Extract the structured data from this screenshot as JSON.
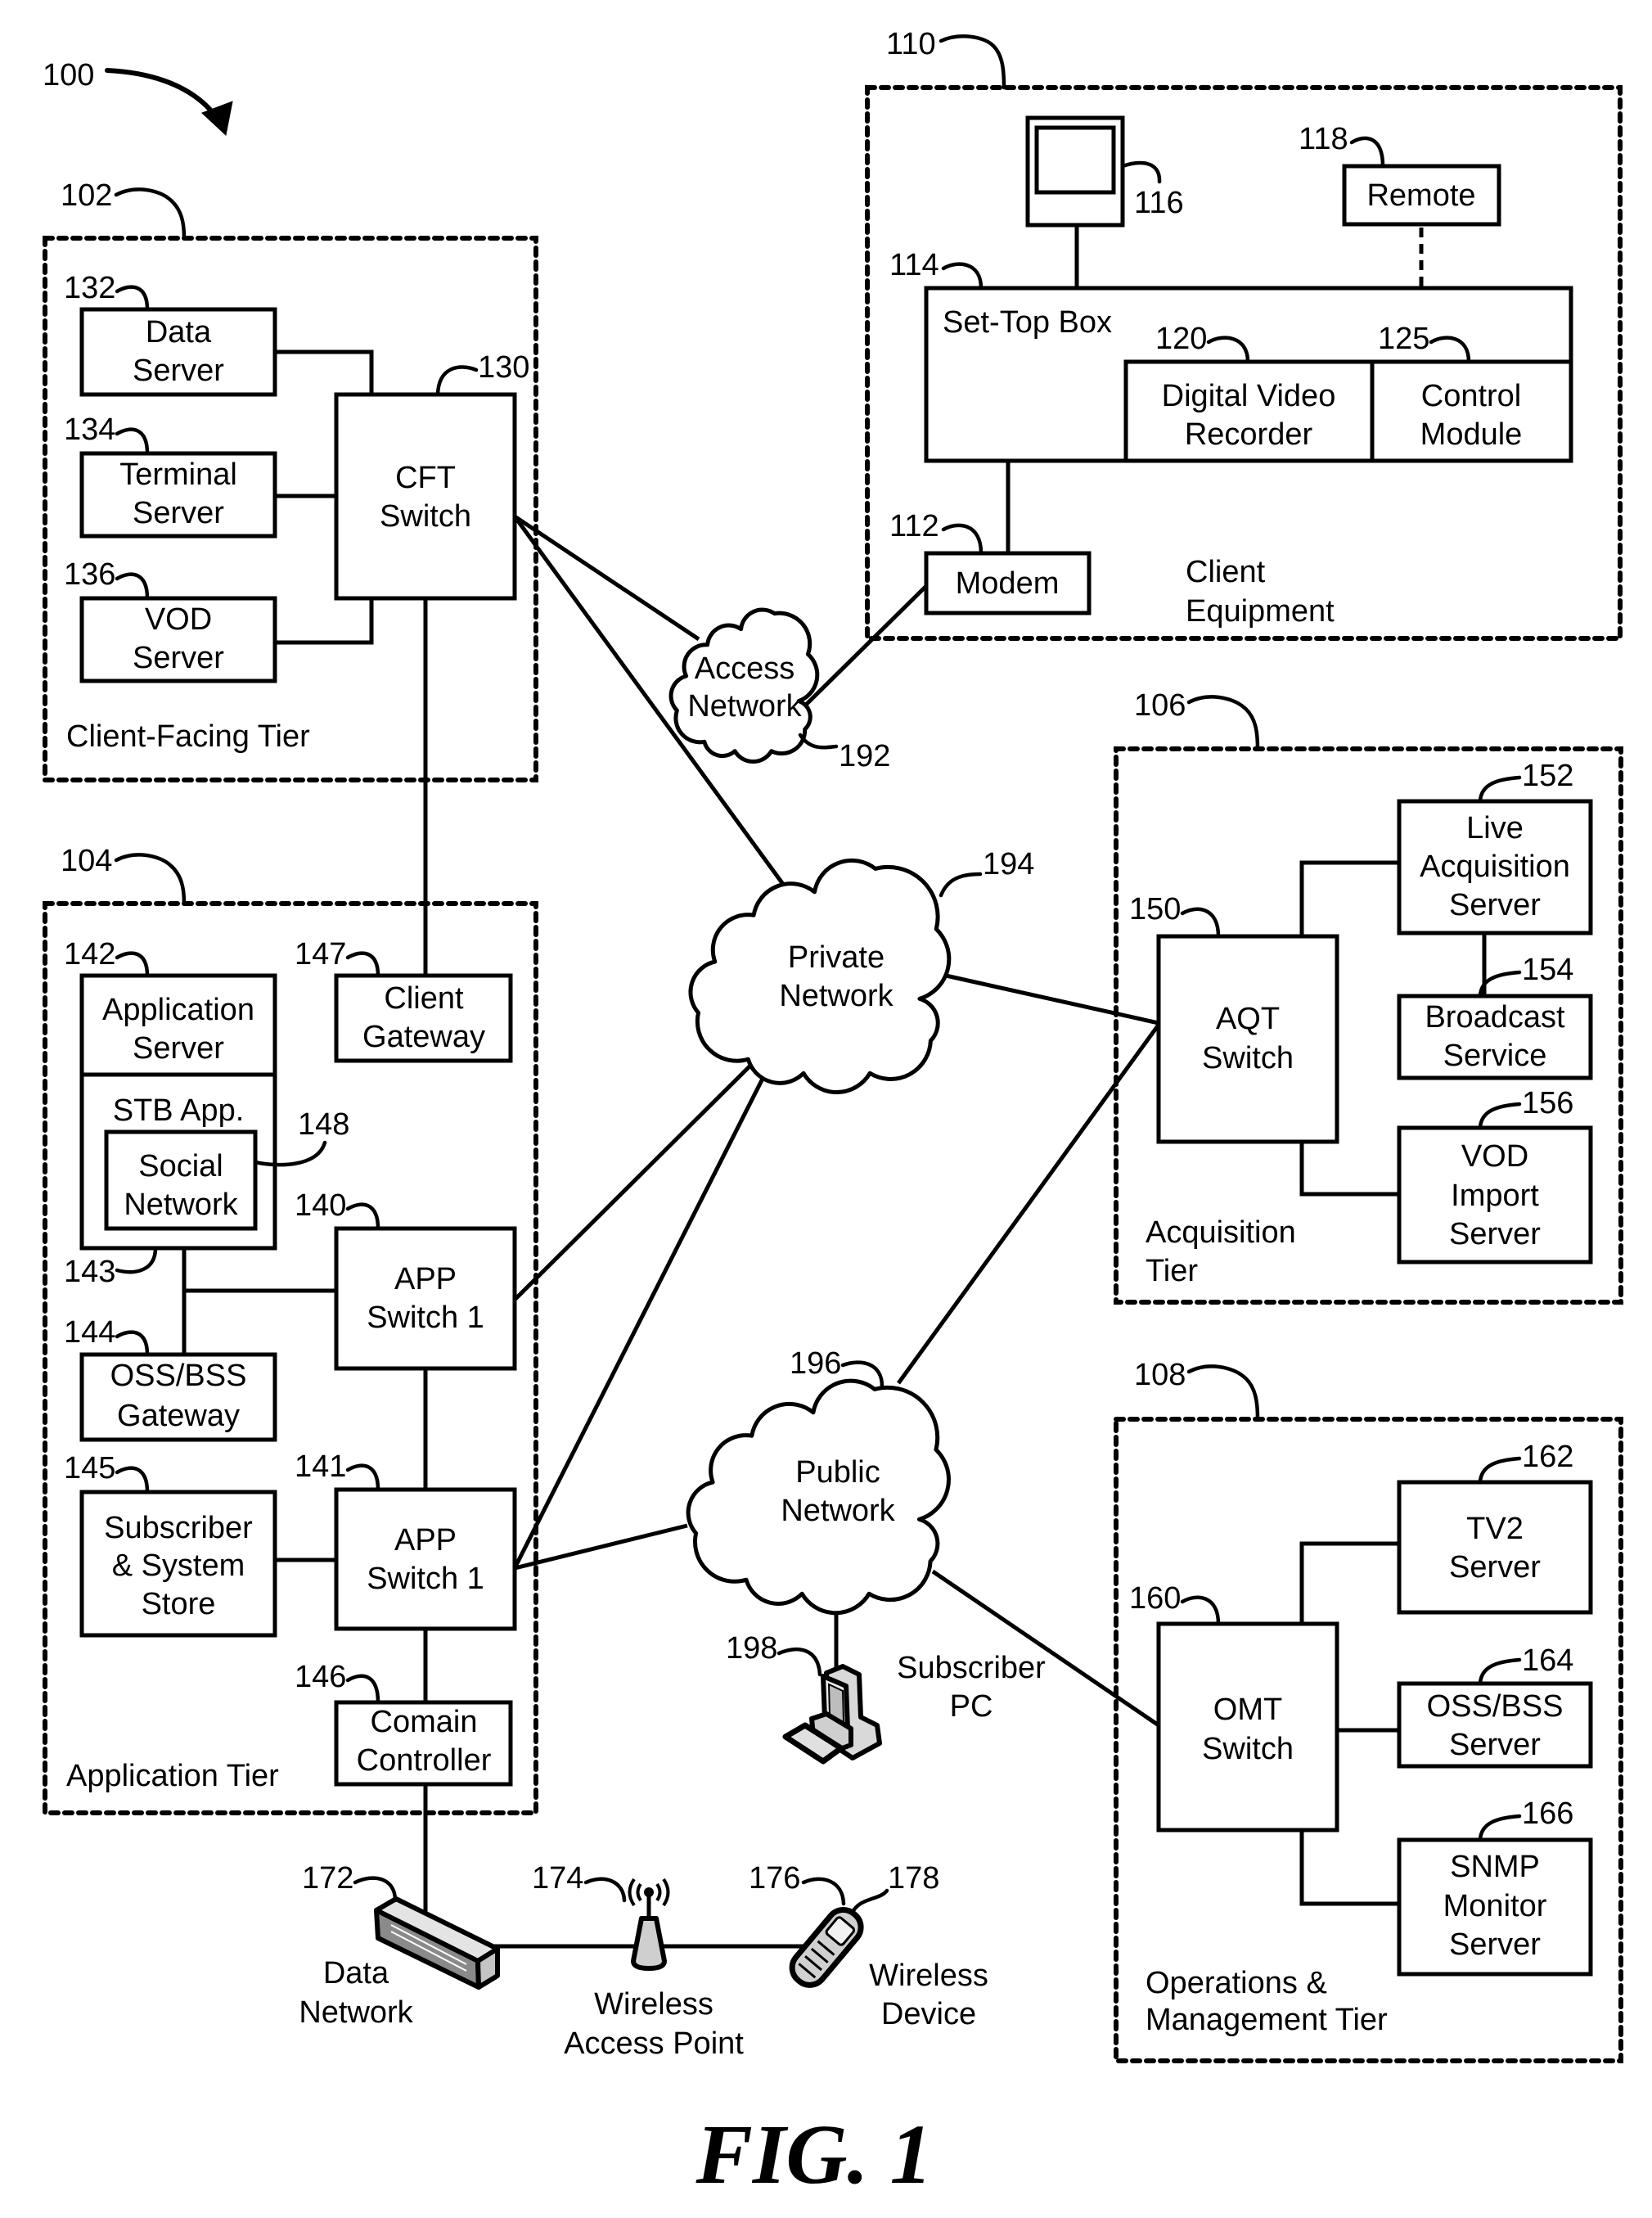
{
  "figure": {
    "ref": "100",
    "caption": "FIG. 1"
  },
  "tiers": {
    "client_facing": {
      "ref": "102",
      "label": "Client-Facing Tier"
    },
    "application": {
      "ref": "104",
      "label": "Application Tier"
    },
    "client_equipment": {
      "ref": "110",
      "label_lines": [
        "Client",
        "Equipment"
      ]
    },
    "acquisition": {
      "ref": "106",
      "label_lines": [
        "Acquisition",
        "Tier"
      ]
    },
    "operations": {
      "ref": "108",
      "label_lines": [
        "Operations &",
        "Management Tier"
      ]
    }
  },
  "nodes": {
    "data_server": {
      "ref": "132",
      "lines": [
        "Data",
        "Server"
      ]
    },
    "terminal_server": {
      "ref": "134",
      "lines": [
        "Terminal",
        "Server"
      ]
    },
    "vod_server": {
      "ref": "136",
      "lines": [
        "VOD",
        "Server"
      ]
    },
    "cft_switch": {
      "ref": "130",
      "lines": [
        "CFT",
        "Switch"
      ]
    },
    "application_server": {
      "ref": "142",
      "lines": [
        "Application",
        "Server"
      ]
    },
    "stb_app": {
      "ref": "143",
      "label": "STB App."
    },
    "social_network": {
      "ref": "148",
      "lines": [
        "Social",
        "Network"
      ]
    },
    "client_gateway": {
      "ref": "147",
      "lines": [
        "Client",
        "Gateway"
      ]
    },
    "app_switch_140": {
      "ref": "140",
      "lines": [
        "APP",
        "Switch 1"
      ]
    },
    "oss_bss_gateway": {
      "ref": "144",
      "lines": [
        "OSS/BSS",
        "Gateway"
      ]
    },
    "subscriber_store": {
      "ref": "145",
      "lines": [
        "Subscriber",
        "& System",
        "Store"
      ]
    },
    "app_switch_141": {
      "ref": "141",
      "lines": [
        "APP",
        "Switch 1"
      ]
    },
    "domain_controller": {
      "ref": "146",
      "lines": [
        "Comain",
        "Controller"
      ]
    },
    "television": {
      "ref": "116"
    },
    "remote": {
      "ref": "118",
      "label": "Remote"
    },
    "set_top_box": {
      "ref": "114",
      "label": "Set-Top Box"
    },
    "dvr": {
      "ref": "120",
      "lines": [
        "Digital Video",
        "Recorder"
      ]
    },
    "control_module": {
      "ref": "125",
      "lines": [
        "Control",
        "Module"
      ]
    },
    "modem": {
      "ref": "112",
      "label": "Modem"
    },
    "live_acquisition_server": {
      "ref": "152",
      "lines": [
        "Live",
        "Acquisition",
        "Server"
      ]
    },
    "aqt_switch": {
      "ref": "150",
      "lines": [
        "AQT",
        "Switch"
      ]
    },
    "broadcast_service": {
      "ref": "154",
      "lines": [
        "Broadcast",
        "Service"
      ]
    },
    "vod_import_server": {
      "ref": "156",
      "lines": [
        "VOD",
        "Import",
        "Server"
      ]
    },
    "tv2_server": {
      "ref": "162",
      "lines": [
        "TV2",
        "Server"
      ]
    },
    "omt_switch": {
      "ref": "160",
      "lines": [
        "OMT",
        "Switch"
      ]
    },
    "oss_bss_server": {
      "ref": "164",
      "lines": [
        "OSS/BSS",
        "Server"
      ]
    },
    "snmp_monitor_server": {
      "ref": "166",
      "lines": [
        "SNMP",
        "Monitor",
        "Server"
      ]
    }
  },
  "networks": {
    "access": {
      "ref": "192",
      "lines": [
        "Access",
        "Network"
      ]
    },
    "private": {
      "ref": "194",
      "lines": [
        "Private",
        "Network"
      ]
    },
    "public": {
      "ref": "196",
      "lines": [
        "Public",
        "Network"
      ]
    }
  },
  "devices": {
    "data_network": {
      "ref": "172",
      "lines": [
        "Data",
        "Network"
      ]
    },
    "wireless_access_point": {
      "ref": "174",
      "lines": [
        "Wireless",
        "Access Point"
      ]
    },
    "wireless_device": {
      "ref": "176",
      "antenna_ref": "178",
      "lines": [
        "Wireless",
        "Device"
      ]
    },
    "subscriber_pc": {
      "ref": "198",
      "lines": [
        "Subscriber",
        "PC"
      ]
    }
  }
}
